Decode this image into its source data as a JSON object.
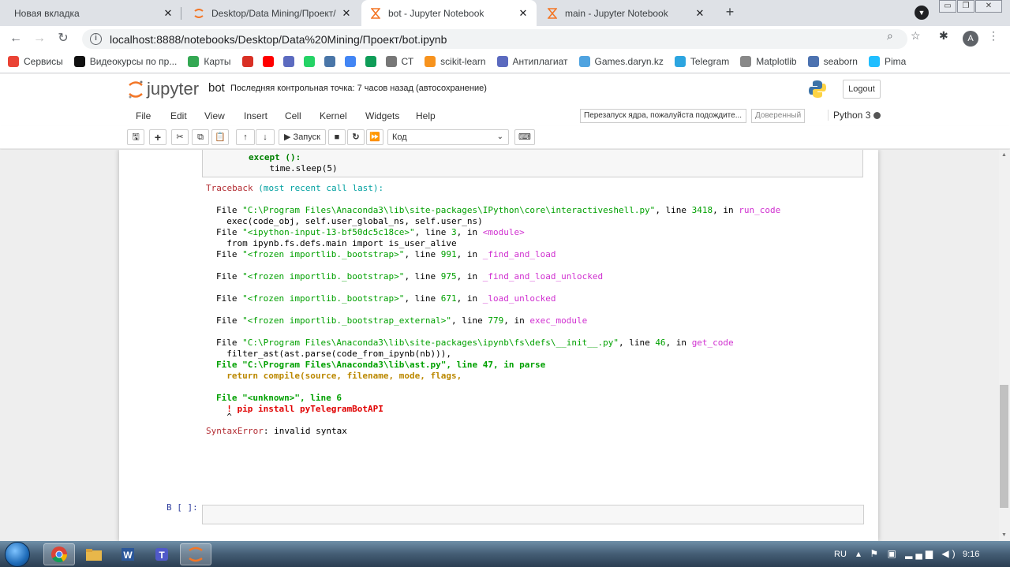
{
  "browser": {
    "tabs": [
      {
        "title": "Новая вкладка",
        "close": "✕",
        "favicon": "none"
      },
      {
        "title": "Desktop/Data Mining/Проект/",
        "close": "✕",
        "favicon": "jupyter-icon"
      },
      {
        "title": "bot - Jupyter Notebook",
        "close": "✕",
        "favicon": "jupyter-hourglass-icon"
      },
      {
        "title": "main - Jupyter Notebook",
        "close": "✕",
        "favicon": "jupyter-hourglass-icon"
      }
    ],
    "new_tab": "+",
    "url": "localhost:8888/notebooks/Desktop/Data%20Mining/Проект/bot.ipynb",
    "profile_initial": "A",
    "bookmarks": [
      {
        "label": "Сервисы",
        "icon": "apps-grid-icon",
        "color": "#ea4335"
      },
      {
        "label": "Видеокурсы по пр...",
        "icon": "it-icon",
        "color": "#111111"
      },
      {
        "label": "Карты",
        "icon": "maps-pin-icon",
        "color": "#34a853"
      },
      {
        "label": "",
        "icon": "gmail-icon",
        "color": "#d93025"
      },
      {
        "label": "",
        "icon": "youtube-icon",
        "color": "#ff0000"
      },
      {
        "label": "",
        "icon": "u-icon",
        "color": "#5c6bc0"
      },
      {
        "label": "",
        "icon": "whatsapp-icon",
        "color": "#25d366"
      },
      {
        "label": "",
        "icon": "vk-icon",
        "color": "#4a76a8"
      },
      {
        "label": "",
        "icon": "translate-icon",
        "color": "#4285f4"
      },
      {
        "label": "",
        "icon": "drive-icon",
        "color": "#0f9d58"
      },
      {
        "label": "СТ",
        "icon": "ct-icon",
        "color": "#777777"
      },
      {
        "label": "scikit-learn",
        "icon": "chart-icon",
        "color": "#f7931e"
      },
      {
        "label": "Антиплагиат",
        "icon": "shield-icon",
        "color": "#5b6abf"
      },
      {
        "label": "Games.daryn.kz",
        "icon": "globe-icon",
        "color": "#4fa3e0"
      },
      {
        "label": "Telegram",
        "icon": "telegram-icon",
        "color": "#2ca5e0"
      },
      {
        "label": "Matplotlib",
        "icon": "matplotlib-icon",
        "color": "#888888"
      },
      {
        "label": "seaborn",
        "icon": "seaborn-icon",
        "color": "#4c72b0"
      },
      {
        "label": "Pima",
        "icon": "k-icon",
        "color": "#20beff"
      }
    ]
  },
  "jupyter": {
    "logo_text": "jupyter",
    "notebook_name": "bot",
    "checkpoint": "Последняя контрольная точка: 7 часов назад  (автосохранение)",
    "logout": "Logout",
    "menu": [
      "File",
      "Edit",
      "View",
      "Insert",
      "Cell",
      "Kernel",
      "Widgets",
      "Help"
    ],
    "kernel_message": "Перезапуск ядра, пожалуйста подождите...",
    "trusted": "Доверенный",
    "kernel_name": "Python 3",
    "toolbar": {
      "run_label": "Запуск",
      "cell_type": "Код"
    }
  },
  "cell": {
    "code_tail": [
      "        except ():",
      "            time.sleep(5)"
    ],
    "traceback_header": "Traceback",
    "traceback_header_rest": "(most recent call last):",
    "frames": [
      {
        "pre": "File ",
        "file": "\"C:\\Program Files\\Anaconda3\\lib\\site-packages\\IPython\\core\\interactiveshell.py\"",
        "mid": ", line ",
        "line": "3418",
        "in": ", in ",
        "func": "run_code",
        "code": "  exec(code_obj, self.user_global_ns, self.user_ns)"
      },
      {
        "pre": "File ",
        "file": "\"<ipython-input-13-bf50dc5c18ce>\"",
        "mid": ", line ",
        "line": "3",
        "in": ", in ",
        "func": "<module>",
        "code": "  from ipynb.fs.defs.main import is_user_alive"
      },
      {
        "pre": "File ",
        "file": "\"<frozen importlib._bootstrap>\"",
        "mid": ", line ",
        "line": "991",
        "in": ", in ",
        "func": "_find_and_load",
        "code": ""
      },
      {
        "pre": "File ",
        "file": "\"<frozen importlib._bootstrap>\"",
        "mid": ", line ",
        "line": "975",
        "in": ", in ",
        "func": "_find_and_load_unlocked",
        "code": ""
      },
      {
        "pre": "File ",
        "file": "\"<frozen importlib._bootstrap>\"",
        "mid": ", line ",
        "line": "671",
        "in": ", in ",
        "func": "_load_unlocked",
        "code": ""
      },
      {
        "pre": "File ",
        "file": "\"<frozen importlib._bootstrap_external>\"",
        "mid": ", line ",
        "line": "779",
        "in": ", in ",
        "func": "exec_module",
        "code": ""
      },
      {
        "pre": "File ",
        "file": "\"C:\\Program Files\\Anaconda3\\lib\\site-packages\\ipynb\\fs\\defs\\__init__.py\"",
        "mid": ", line ",
        "line": "46",
        "in": ", in ",
        "func": "get_code",
        "code": "  filter_ast(ast.parse(code_from_ipynb(nb))),"
      }
    ],
    "ast_frame": {
      "text": "File \"C:\\Program Files\\Anaconda3\\lib\\ast.py\", line 47, in parse",
      "code": "  return compile(source, filename, mode, flags,"
    },
    "unknown_frame": {
      "text": "File \"<unknown>\", line 6",
      "code": "  ! pip install pyTelegramBotAPI",
      "caret": "  ^"
    },
    "error_type": "SyntaxError",
    "error_message": ": invalid syntax"
  },
  "empty_cell_prompt": "В [ ]:",
  "taskbar": {
    "language": "RU",
    "time": "9:16",
    "apps": [
      "chrome-icon",
      "explorer-icon",
      "word-icon",
      "teams-icon",
      "jupyter-icon"
    ]
  }
}
